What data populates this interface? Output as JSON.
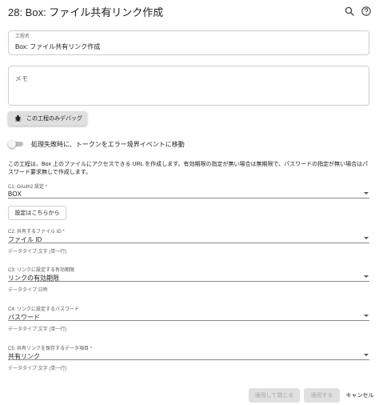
{
  "header": {
    "title": "28: Box: ファイル共有リンク作成",
    "icons": [
      "search-icon",
      "help-icon"
    ]
  },
  "step_name": {
    "label": "工程名",
    "value": "Box: ファイル共有リンク作成"
  },
  "memo": {
    "placeholder": "メモ"
  },
  "debug_button": {
    "icon": "bug-icon",
    "label": "この工程のみデバッグ"
  },
  "error_toggle": {
    "label": "処理失敗時に、トークンをエラー境界イベントに移動",
    "checked": false
  },
  "description": "この工程は、Box 上のファイルにアクセスできる URL を作成します。有効期限の指定が無い場合は無期限で、パスワードの指定が無い場合はパスワード要求無しで作成します。",
  "fields": {
    "c1": {
      "label": "C1: OAuth2 設定 *",
      "value": "BOX"
    },
    "settings_button": "設定はこちらから",
    "c2": {
      "label": "C2: 共有するファイル ID *",
      "value": "ファイル ID",
      "helper": "データタイプ:文字 (単一行)"
    },
    "c3": {
      "label": "C3: リンクに設定する有効期限",
      "value": "リンクの有効期限",
      "helper": "データタイプ:日時"
    },
    "c4": {
      "label": "C4: リンクに設定するパスワード",
      "value": "パスワード",
      "helper": "データタイプ:文字 (単一行)"
    },
    "c5": {
      "label": "C5: 共有リンクを保存するデータ項目 *",
      "value": "共有リンク",
      "helper": "データタイプ:文字 (単一行)"
    }
  },
  "footer": {
    "apply_close": "適用して閉じる",
    "apply": "適用する",
    "cancel": "キャンセル"
  },
  "colors": {
    "disabled_text": "#a8a8a8",
    "disabled_bg": "#e0e0e0",
    "border": "#cfcfcf"
  }
}
